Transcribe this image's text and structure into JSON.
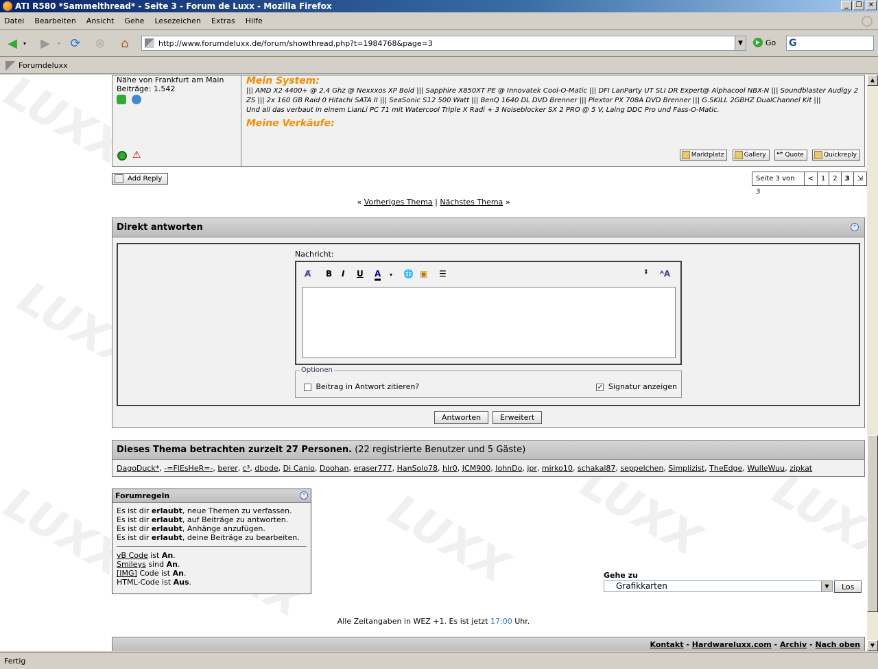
{
  "window": {
    "title": "ATI R580 *Sammelthread* - Seite 3 - Forum de Luxx - Mozilla Firefox"
  },
  "menu": [
    "Datei",
    "Bearbeiten",
    "Ansicht",
    "Gehe",
    "Lesezeichen",
    "Extras",
    "Hilfe"
  ],
  "nav": {
    "url": "http://www.forumdeluxx.de/forum/showthread.php?t=1984768&page=3",
    "go_label": "Go"
  },
  "bookmarks": [
    {
      "label": "Forumdeluxx"
    }
  ],
  "post": {
    "location": "Nähe von Frankfurt am Main",
    "posts": "Beiträge: 1.542",
    "sys_heading": "Mein System:",
    "sys_line1": "||| AMD X2 4400+ @ 2,4 Ghz @ Nexxxos XP Bold ||| Sapphire X850XT PE @ Innovatek Cool-O-Matic ||| DFI LanParty UT SLI DR Expert@ Alphacool NBX-N ||| Soundblaster Audigy 2 ZS ||| 2x 160 GB Raid 0 Hitachi SATA II ||| SeaSonic S12 500 Watt ||| BenQ 1640 DL DVD Brenner ||| Plextor PX 708A DVD Brenner ||| G.SKILL 2GBHZ DualChannel Kit |||",
    "sys_line2": "Und all das verbaut in einem LianLi PC 71 mit Watercool Triple X Radi + 3 Noiseblocker SX 2 PRO @ 5 V, Laing DDC Pro und Fass-O-Matic.",
    "sales_heading": "Meine Verkäufe:",
    "buttons": {
      "market": "Marktplatz",
      "gallery": "Gallery",
      "quote": "Quote",
      "quickreply": "Quickreply"
    }
  },
  "add_reply": "Add Reply",
  "pager": {
    "label": "Seite 3 von 3",
    "prev": "<",
    "pages": [
      "1",
      "2",
      "3"
    ],
    "last": "⇲"
  },
  "thread_nav": {
    "prev": "Vorheriges Thema",
    "sep": "|",
    "next": "Nächstes Thema",
    "left": "«",
    "right": "»"
  },
  "quick_reply": {
    "title": "Direkt antworten",
    "message_label": "Nachricht:",
    "options_legend": "Optionen",
    "quote_label": "Beitrag in Antwort zitieren?",
    "sig_label": "Signatur anzeigen",
    "submit": "Antworten",
    "advanced": "Erweitert"
  },
  "viewers": {
    "heading": "Dieses Thema betrachten zurzeit 27 Personen.",
    "sub": "(22 registrierte Benutzer und 5 Gäste)",
    "users": [
      "DagoDuck*",
      "-=FlEsHeR=-",
      "berer",
      "c³",
      "dbode",
      "Di Canio",
      "Doohan",
      "eraser777",
      "HanSolo78",
      "hIr0",
      "JCM900",
      "JohnDo",
      "jpr",
      "mirko10",
      "schakal87",
      "seppelchen",
      "Simplizist",
      "TheEdge",
      "WulleWuu",
      "zipkat"
    ]
  },
  "rules": {
    "title": "Forumregeln",
    "lines": [
      {
        "pre": "Es ist dir ",
        "bold": "erlaubt",
        "post": ", neue Themen zu verfassen."
      },
      {
        "pre": "Es ist dir ",
        "bold": "erlaubt",
        "post": ", auf Beiträge zu antworten."
      },
      {
        "pre": "Es ist dir ",
        "bold": "erlaubt",
        "post": ", Anhänge anzufügen."
      },
      {
        "pre": "Es ist dir ",
        "bold": "erlaubt",
        "post": ", deine Beiträge zu bearbeiten."
      }
    ],
    "codes": [
      {
        "link": "vB Code",
        "mid": " ist ",
        "val": "An",
        "end": "."
      },
      {
        "link": "Smileys",
        "mid": " sind ",
        "val": "An",
        "end": "."
      },
      {
        "link": "[IMG]",
        "mid": " Code ist ",
        "val": "An",
        "end": "."
      },
      {
        "link": "",
        "mid": "HTML-Code ist ",
        "val": "Aus",
        "end": "."
      }
    ]
  },
  "jump": {
    "label": "Gehe zu",
    "selected": "Grafikkarten",
    "button": "Los"
  },
  "time": {
    "pre": "Alle Zeitangaben in WEZ +1. Es ist jetzt",
    "time": "17:00",
    "post": "Uhr."
  },
  "footer": {
    "links": [
      "Kontakt",
      "Hardwareluxx.com",
      "Archiv",
      "Nach oben"
    ],
    "sep": "-"
  },
  "status": "Fertig",
  "watermark": "LUXX"
}
